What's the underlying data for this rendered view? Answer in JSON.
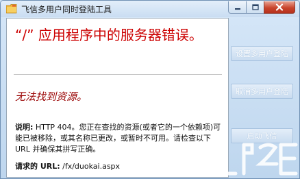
{
  "window": {
    "title": "飞信多用户同时登陆工具"
  },
  "error_page": {
    "heading": "“/” 应用程序中的服务器错误。",
    "subheading": "无法找到资源。",
    "description_label": "说明:",
    "description_text": " HTTP 404。您正在查找的资源(或者它的一个依赖项)可能已被移除，或其名称已更改，或暂时不可用。请检查以下 URL 并确保其拼写正确。",
    "url_label": "请求的 URL:",
    "url_value": " /fx/duokai.aspx"
  },
  "buttons": {
    "setup_label": "设置多用户登陆",
    "cancel_label": "取消多用户登陆",
    "launch_label": "启动飞信"
  },
  "colors": {
    "error_red": "#cc0000",
    "subheading_red": "#990000",
    "window_bg": "#cfe3f5"
  }
}
